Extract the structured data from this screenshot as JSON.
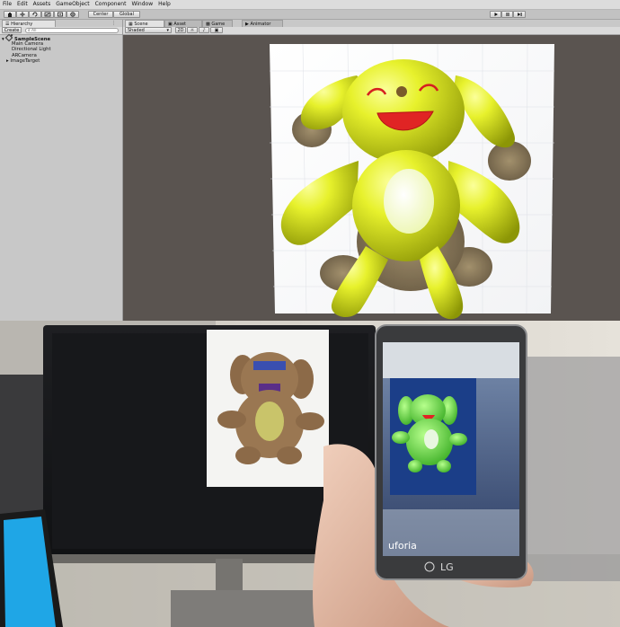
{
  "menu": [
    "File",
    "Edit",
    "Assets",
    "GameObject",
    "Component",
    "Window",
    "Help"
  ],
  "toolbar": {
    "pivot_label": "Center",
    "space_label": "Global"
  },
  "hierarchy": {
    "tab_label": "Hierarchy",
    "create_label": "Create",
    "search_placeholder": "All",
    "scene_name": "SampleScene",
    "items": [
      "Main Camera",
      "Directional Light",
      "ARCamera",
      "ImageTarget"
    ]
  },
  "scene_view": {
    "tabs": [
      "Scene",
      "Asset Store",
      "Game",
      "Animator"
    ],
    "shading_mode": "Shaded",
    "mode_2d": "2D"
  },
  "phone": {
    "brand": "LG",
    "app_watermark": "uforia"
  },
  "colors": {
    "toy_yellow": "#e3ee2a",
    "toy_green": "#6de04a",
    "toy_brown": "#8c6a48",
    "viewport_bg": "#5a5450"
  }
}
